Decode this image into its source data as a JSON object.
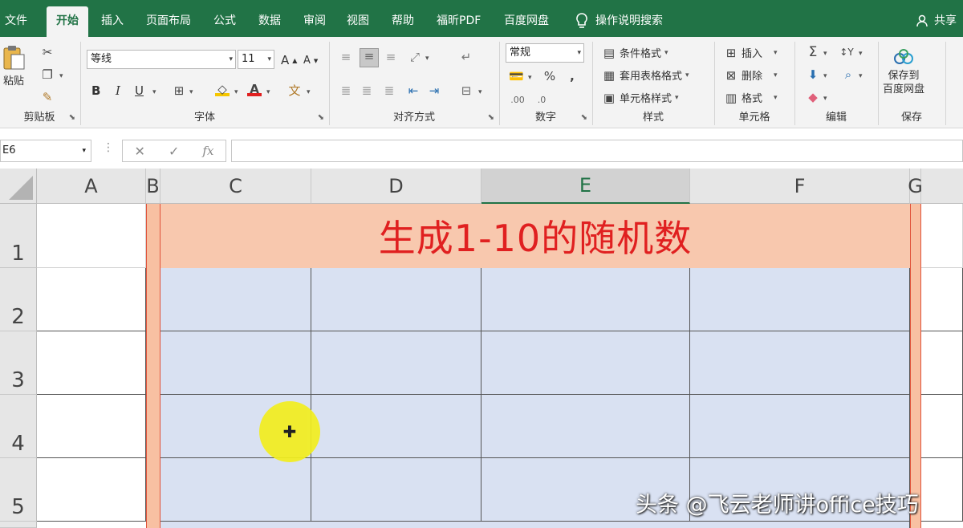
{
  "tabs": [
    "文件",
    "开始",
    "插入",
    "页面布局",
    "公式",
    "数据",
    "审阅",
    "视图",
    "帮助",
    "福昕PDF",
    "百度网盘"
  ],
  "active_tab": "开始",
  "tell_me": "操作说明搜索",
  "share": "共享",
  "ribbon": {
    "clipboard": {
      "paste": "粘贴",
      "label": "剪贴板"
    },
    "font": {
      "name": "等线",
      "size": "11",
      "bold": "B",
      "italic": "I",
      "underline": "U",
      "label": "字体"
    },
    "alignment": {
      "label": "对齐方式"
    },
    "number": {
      "format": "常规",
      "label": "数字"
    },
    "styles": {
      "conditional": "条件格式",
      "table": "套用表格格式",
      "cell": "单元格样式",
      "label": "样式"
    },
    "cells": {
      "insert": "插入",
      "delete": "删除",
      "format": "格式",
      "label": "单元格"
    },
    "editing": {
      "label": "编辑"
    },
    "save": {
      "button": "保存到\n百度网盘",
      "label": "保存"
    }
  },
  "formula_bar": {
    "name_box": "E6",
    "fx": "fx",
    "value": ""
  },
  "grid": {
    "columns": [
      "A",
      "B",
      "C",
      "D",
      "E",
      "F",
      "G"
    ],
    "selected_column": "E",
    "rows": [
      "1",
      "2",
      "3",
      "4",
      "5"
    ],
    "title": "生成1-10的随机数"
  },
  "colors": {
    "accent": "#217346",
    "header_fill": "#f8c8ae",
    "title_text": "#e02020",
    "table_fill": "#d9e1f2"
  },
  "watermark": "头条 @飞云老师讲office技巧"
}
